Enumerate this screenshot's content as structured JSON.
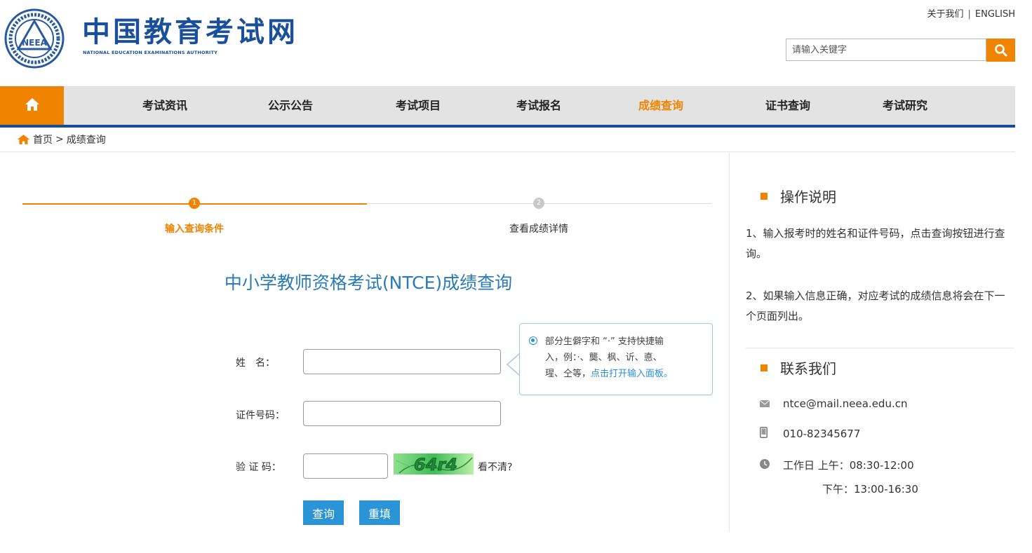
{
  "header": {
    "site_title": "中国教育考试网",
    "site_subtitle": "NATIONAL EDUCATION EXAMINATIONS AUTHORITY",
    "logo_text": "NEEA",
    "top_links": [
      "关于我们",
      "ENGLISH"
    ],
    "search_placeholder": "请输入关键字"
  },
  "nav": {
    "items": [
      "考试资讯",
      "公示公告",
      "考试项目",
      "考试报名",
      "成绩查询",
      "证书查询",
      "考试研究"
    ],
    "active": "成绩查询"
  },
  "breadcrumb": {
    "home": "首页",
    "separator": ">",
    "current": "成绩查询"
  },
  "steps": [
    {
      "number": "1",
      "label": "输入查询条件",
      "active": true
    },
    {
      "number": "2",
      "label": "查看成绩详情",
      "active": false
    }
  ],
  "form": {
    "title": "中小学教师资格考试(NTCE)成绩查询",
    "name_label": "姓　名：",
    "id_label": "证件号码：",
    "captcha_label": "验 证 码：",
    "captcha_image_text": "64r4",
    "captcha_refresh": "看不清?",
    "tip_line1": "部分生僻字和 “·” 支持快捷输",
    "tip_line2": "入，例：·、龑、枫、䜣、悳、",
    "tip_line3_prefix": "瑆、仝等，",
    "tip_link": "点击打开输入面板。",
    "submit": "查询",
    "reset": "重填"
  },
  "sidebar": {
    "instructions_title": "操作说明",
    "instruction_1": "1、输入报考时的姓名和证件号码，点击查询按钮进行查询。",
    "instruction_2": "2、如果输入信息正确，对应考试的成绩信息将会在下一个页面列出。",
    "contact_title": "联系我们",
    "email": "ntce@mail.neea.edu.cn",
    "phone": "010-82345677",
    "hours_am": "工作日 上午：08:30-12:00",
    "hours_pm": "下午：13:00-16:30"
  },
  "colors": {
    "brand_blue": "#1a4f9c",
    "accent_orange": "#f08300",
    "link_blue": "#2a94d6"
  }
}
